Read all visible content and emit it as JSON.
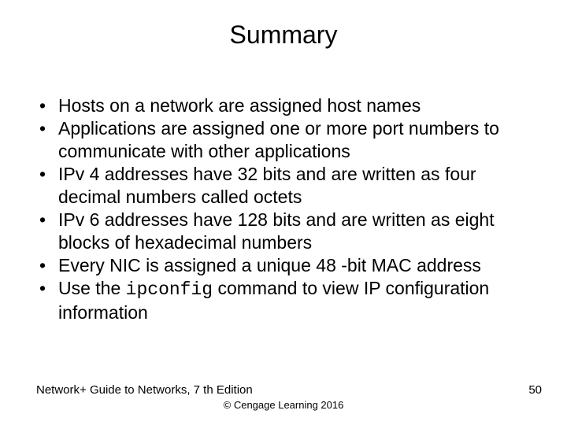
{
  "title": "Summary",
  "bullets": [
    {
      "pre": "Hosts on a network are assigned host names",
      "cmd": "",
      "post": ""
    },
    {
      "pre": "Applications are assigned one or more port numbers to communicate with other applications",
      "cmd": "",
      "post": ""
    },
    {
      "pre": "IPv 4 addresses have 32 bits and are written as four decimal numbers called octets",
      "cmd": "",
      "post": ""
    },
    {
      "pre": "IPv 6 addresses have 128 bits and are written as eight blocks of hexadecimal numbers",
      "cmd": "",
      "post": ""
    },
    {
      "pre": "Every NIC is assigned a unique 48 -bit MAC address",
      "cmd": "",
      "post": ""
    },
    {
      "pre": "Use the ",
      "cmd": "ipconfig",
      "post": " command to view IP configuration information"
    }
  ],
  "footer": {
    "left": "Network+ Guide to Networks, 7 th Edition",
    "center": "© Cengage Learning  2016",
    "right": "50"
  }
}
